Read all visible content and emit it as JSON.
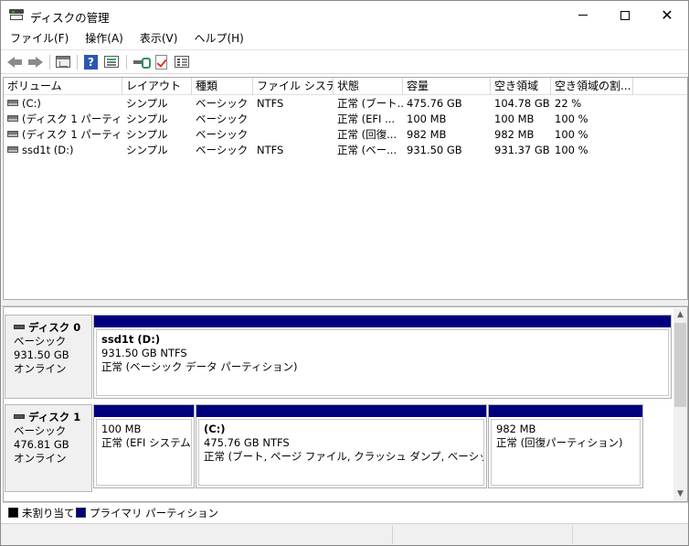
{
  "window": {
    "title": "ディスクの管理",
    "minimize_label": "—",
    "maximize_label": "",
    "close_label": "✕"
  },
  "menu": [
    {
      "label": "ファイル(F)"
    },
    {
      "label": "操作(A)"
    },
    {
      "label": "表示(V)"
    },
    {
      "label": "ヘルプ(H)"
    }
  ],
  "toolbar": {
    "icons": [
      "back-arrow-icon",
      "forward-arrow-icon",
      "console-tree-icon",
      "help-icon",
      "action-pane-icon",
      "connect-drive-icon",
      "check-icon",
      "properties-icon"
    ]
  },
  "volume_table": {
    "columns": [
      "ボリューム",
      "レイアウト",
      "種類",
      "ファイル システム",
      "状態",
      "容量",
      "空き領域",
      "空き領域の割..."
    ],
    "rows": [
      [
        "(C:)",
        "シンプル",
        "ベーシック",
        "NTFS",
        "正常 (ブート...",
        "475.76 GB",
        "104.78 GB",
        "22 %"
      ],
      [
        "(ディスク 1 パーティシ...",
        "シンプル",
        "ベーシック",
        "",
        "正常 (EFI ...",
        "100 MB",
        "100 MB",
        "100 %"
      ],
      [
        "(ディスク 1 パーティシ...",
        "シンプル",
        "ベーシック",
        "",
        "正常 (回復...",
        "982 MB",
        "982 MB",
        "100 %"
      ],
      [
        "ssd1t (D:)",
        "シンプル",
        "ベーシック",
        "NTFS",
        "正常 (ベー...",
        "931.50 GB",
        "931.37 GB",
        "100 %"
      ]
    ]
  },
  "disks": [
    {
      "name": "ディスク 0",
      "type": "ベーシック",
      "size": "931.50 GB",
      "status": "オンライン",
      "partitions": [
        {
          "name": "ssd1t  (D:)",
          "size_fs": "931.50 GB NTFS",
          "status": "正常 (ベーシック データ パーティション)"
        }
      ]
    },
    {
      "name": "ディスク 1",
      "type": "ベーシック",
      "size": "476.81 GB",
      "status": "オンライン",
      "partitions": [
        {
          "name": "",
          "size_fs": "100 MB",
          "status": "正常 (EFI システム パ"
        },
        {
          "name": "(C:)",
          "size_fs": "475.76 GB NTFS",
          "status": "正常 (ブート, ページ ファイル, クラッシュ ダンプ, ベーシック データ パー"
        },
        {
          "name": "",
          "size_fs": "982 MB",
          "status": "正常 (回復パーティション)"
        }
      ]
    }
  ],
  "legend": [
    {
      "label": "未割り当て",
      "color": "#000000"
    },
    {
      "label": "プライマリ パーティション",
      "color": "#00007f"
    }
  ],
  "colors": {
    "partition_bar": "#00007f",
    "unallocated": "#000000"
  }
}
